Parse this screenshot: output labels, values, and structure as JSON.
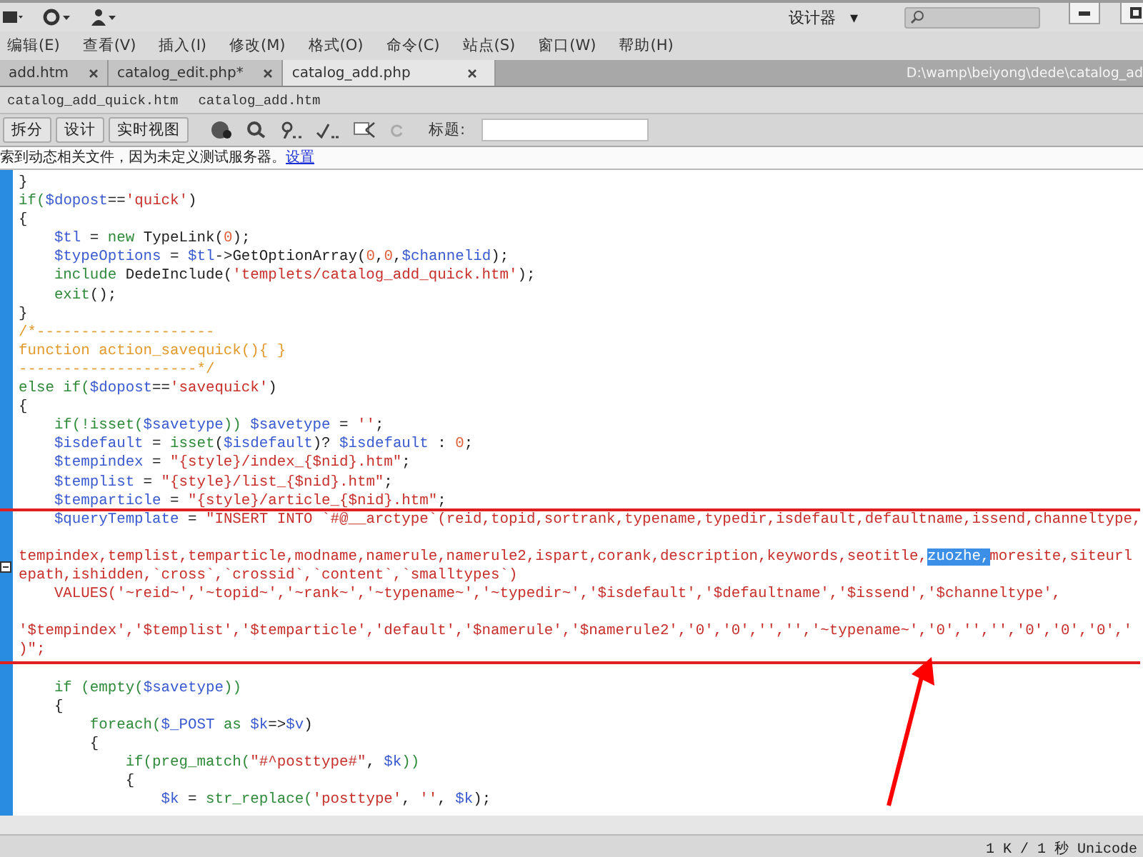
{
  "top_bar": {
    "workspace": "设计器",
    "workspace_caret": "▾"
  },
  "menu": [
    "编辑(E)",
    "查看(V)",
    "插入(I)",
    "修改(M)",
    "格式(O)",
    "命令(C)",
    "站点(S)",
    "窗口(W)",
    "帮助(H)"
  ],
  "document_tabs": [
    {
      "label": "add.htm",
      "selected": false
    },
    {
      "label": "catalog_edit.php*",
      "selected": false
    },
    {
      "label": "catalog_add.php",
      "selected": true
    }
  ],
  "file_path": "D:\\wamp\\beiyong\\dede\\catalog_ad",
  "related_files": [
    "catalog_add_quick.htm",
    "catalog_add.htm"
  ],
  "toolbar": {
    "view_buttons": [
      "拆分",
      "设计",
      "实时视图"
    ],
    "title_label": "标题:"
  },
  "info_bar": {
    "text": "索到动态相关文件，因为未定义测试服务器。",
    "link": "设置"
  },
  "code_lines": [
    {
      "segments": [
        {
          "t": "}",
          "color": "#222222"
        }
      ]
    },
    {
      "segments": [
        {
          "t": "if(",
          "color": "#2f8a3a"
        },
        {
          "t": "$dopost",
          "color": "#3a5bd0"
        },
        {
          "t": "==",
          "color": "#222222"
        },
        {
          "t": "'quick'",
          "color": "#c8302c"
        },
        {
          "t": ")",
          "color": "#222222"
        }
      ]
    },
    {
      "segments": [
        {
          "t": "{",
          "color": "#222222"
        }
      ]
    },
    {
      "segments": [
        {
          "t": "    $tl",
          "color": "#3a5bd0"
        },
        {
          "t": " = ",
          "color": "#222222"
        },
        {
          "t": "new",
          "color": "#2f8a3a"
        },
        {
          "t": " TypeLink(",
          "color": "#222222"
        },
        {
          "t": "0",
          "color": "#e0603a"
        },
        {
          "t": ");",
          "color": "#222222"
        }
      ]
    },
    {
      "segments": [
        {
          "t": "    $typeOptions",
          "color": "#3a5bd0"
        },
        {
          "t": " = ",
          "color": "#222222"
        },
        {
          "t": "$tl",
          "color": "#3a5bd0"
        },
        {
          "t": "->GetOptionArray(",
          "color": "#222222"
        },
        {
          "t": "0",
          "color": "#e0603a"
        },
        {
          "t": ",",
          "color": "#222222"
        },
        {
          "t": "0",
          "color": "#e0603a"
        },
        {
          "t": ",",
          "color": "#222222"
        },
        {
          "t": "$channelid",
          "color": "#3a5bd0"
        },
        {
          "t": ");",
          "color": "#222222"
        }
      ]
    },
    {
      "segments": [
        {
          "t": "    include",
          "color": "#2f8a3a"
        },
        {
          "t": " DedeInclude(",
          "color": "#222222"
        },
        {
          "t": "'templets/catalog_add_quick.htm'",
          "color": "#c8302c"
        },
        {
          "t": ");",
          "color": "#222222"
        }
      ]
    },
    {
      "segments": [
        {
          "t": "    exit",
          "color": "#2f8a3a"
        },
        {
          "t": "();",
          "color": "#222222"
        }
      ]
    },
    {
      "segments": [
        {
          "t": "}",
          "color": "#222222"
        }
      ]
    },
    {
      "segments": [
        {
          "t": "/*--------------------",
          "color": "#e39a2c"
        }
      ]
    },
    {
      "segments": [
        {
          "t": "function action_savequick(){ }",
          "color": "#e39a2c"
        }
      ]
    },
    {
      "segments": [
        {
          "t": "--------------------*/",
          "color": "#e39a2c"
        }
      ]
    },
    {
      "segments": [
        {
          "t": "else if(",
          "color": "#2f8a3a"
        },
        {
          "t": "$dopost",
          "color": "#3a5bd0"
        },
        {
          "t": "==",
          "color": "#222222"
        },
        {
          "t": "'savequick'",
          "color": "#c8302c"
        },
        {
          "t": ")",
          "color": "#222222"
        }
      ]
    },
    {
      "segments": [
        {
          "t": "{",
          "color": "#222222"
        }
      ]
    },
    {
      "segments": [
        {
          "t": "    if(!isset(",
          "color": "#2f8a3a"
        },
        {
          "t": "$savetype",
          "color": "#3a5bd0"
        },
        {
          "t": "))",
          "color": "#2f8a3a"
        },
        {
          "t": " $savetype",
          "color": "#3a5bd0"
        },
        {
          "t": " = ",
          "color": "#222222"
        },
        {
          "t": "''",
          "color": "#c8302c"
        },
        {
          "t": ";",
          "color": "#222222"
        }
      ]
    },
    {
      "segments": [
        {
          "t": "    $isdefault",
          "color": "#3a5bd0"
        },
        {
          "t": " = ",
          "color": "#222222"
        },
        {
          "t": "isset",
          "color": "#2f8a3a"
        },
        {
          "t": "(",
          "color": "#222222"
        },
        {
          "t": "$isdefault",
          "color": "#3a5bd0"
        },
        {
          "t": ")? ",
          "color": "#222222"
        },
        {
          "t": "$isdefault",
          "color": "#3a5bd0"
        },
        {
          "t": " : ",
          "color": "#222222"
        },
        {
          "t": "0",
          "color": "#e0603a"
        },
        {
          "t": ";",
          "color": "#222222"
        }
      ]
    },
    {
      "segments": [
        {
          "t": "    $tempindex",
          "color": "#3a5bd0"
        },
        {
          "t": " = ",
          "color": "#222222"
        },
        {
          "t": "\"{style}/index_{$nid}.htm\"",
          "color": "#c8302c"
        },
        {
          "t": ";",
          "color": "#222222"
        }
      ]
    },
    {
      "segments": [
        {
          "t": "    $templist",
          "color": "#3a5bd0"
        },
        {
          "t": " = ",
          "color": "#222222"
        },
        {
          "t": "\"{style}/list_{$nid}.htm\"",
          "color": "#c8302c"
        },
        {
          "t": ";",
          "color": "#222222"
        }
      ]
    },
    {
      "segments": [
        {
          "t": "    $temparticle",
          "color": "#3a5bd0"
        },
        {
          "t": " = ",
          "color": "#222222"
        },
        {
          "t": "\"{style}/article_{$nid}.htm\"",
          "color": "#c8302c"
        },
        {
          "t": ";",
          "color": "#222222"
        }
      ]
    },
    {
      "segments": [
        {
          "t": "    $queryTemplate",
          "color": "#3a5bd0"
        },
        {
          "t": " = ",
          "color": "#222222"
        },
        {
          "t": "\"INSERT INTO `#@__arctype`(reid,topid,sortrank,typename,typedir,isdefault,defaultname,issend,channeltype,",
          "color": "#c8302c"
        }
      ]
    },
    {
      "gap_before": true,
      "segments": [
        {
          "t": "tempindex,templist,temparticle,modname,namerule,namerule2,ispart,corank,description,keywords,seotitle,",
          "color": "#c8302c",
          "selected": false
        },
        {
          "t": "zuozhe,",
          "selected": true
        },
        {
          "t": "moresite,siteurl",
          "color": "#c8302c",
          "selected": false
        }
      ]
    },
    {
      "segments": [
        {
          "t": "epath,ishidden,`cross`,`crossid`,`content`,`smalltypes`)",
          "color": "#c8302c"
        }
      ]
    },
    {
      "segments": [
        {
          "t": "    VALUES('~reid~','~topid~','~rank~','~typename~','~typedir~','$isdefault','$defaultname','$issend','$channeltype',",
          "color": "#c8302c"
        }
      ]
    },
    {
      "gap_before": true,
      "segments": [
        {
          "t": "'$tempindex','$templist','$temparticle','default','$namerule','$namerule2','0','0','','','~typename~','0','','','0','0','0','",
          "color": "#c8302c"
        }
      ]
    },
    {
      "segments": [
        {
          "t": ")\";",
          "color": "#c8302c"
        }
      ]
    },
    {
      "gap_before": true,
      "segments": [
        {
          "t": "    if (",
          "color": "#2f8a3a"
        },
        {
          "t": "empty",
          "color": "#2f8a3a"
        },
        {
          "t": "(",
          "color": "#2f8a3a"
        },
        {
          "t": "$savetype",
          "color": "#3a5bd0"
        },
        {
          "t": "))",
          "color": "#2f8a3a"
        }
      ]
    },
    {
      "segments": [
        {
          "t": "    {",
          "color": "#222222"
        }
      ]
    },
    {
      "segments": [
        {
          "t": "        foreach(",
          "color": "#2f8a3a"
        },
        {
          "t": "$_POST",
          "color": "#3a5bd0"
        },
        {
          "t": " as ",
          "color": "#2f8a3a"
        },
        {
          "t": "$k",
          "color": "#3a5bd0"
        },
        {
          "t": "=>",
          "color": "#222222"
        },
        {
          "t": "$v",
          "color": "#3a5bd0"
        },
        {
          "t": ")",
          "color": "#222222"
        }
      ]
    },
    {
      "segments": [
        {
          "t": "        {",
          "color": "#222222"
        }
      ]
    },
    {
      "segments": [
        {
          "t": "            if(",
          "color": "#2f8a3a"
        },
        {
          "t": "preg_match(",
          "color": "#2f8a3a"
        },
        {
          "t": "\"#^posttype#\"",
          "color": "#c8302c"
        },
        {
          "t": ", ",
          "color": "#222222"
        },
        {
          "t": "$k",
          "color": "#3a5bd0"
        },
        {
          "t": "))",
          "color": "#2f8a3a"
        }
      ]
    },
    {
      "segments": [
        {
          "t": "            {",
          "color": "#222222"
        }
      ]
    },
    {
      "segments": [
        {
          "t": "                $k",
          "color": "#3a5bd0"
        },
        {
          "t": " = ",
          "color": "#222222"
        },
        {
          "t": "str_replace(",
          "color": "#2f8a3a"
        },
        {
          "t": "'posttype'",
          "color": "#c8302c"
        },
        {
          "t": ", ",
          "color": "#222222"
        },
        {
          "t": "''",
          "color": "#c8302c"
        },
        {
          "t": ", ",
          "color": "#222222"
        },
        {
          "t": "$k",
          "color": "#3a5bd0"
        },
        {
          "t": ");",
          "color": "#222222"
        }
      ]
    }
  ],
  "status": "1 K / 1 秒 Unicode"
}
